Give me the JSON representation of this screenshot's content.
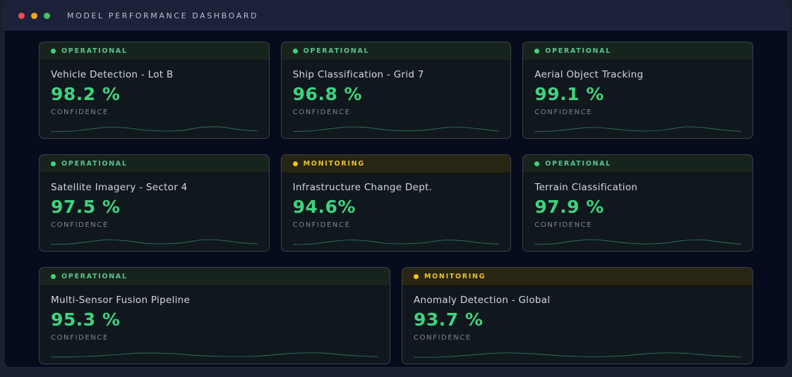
{
  "window": {
    "title": "MODEL PERFORMANCE DASHBOARD",
    "traffic_lights": [
      {
        "name": "close-button",
        "color": "#ef4d4d"
      },
      {
        "name": "minimize-button",
        "color": "#f2a71e"
      },
      {
        "name": "zoom-button",
        "color": "#3ec45f"
      }
    ]
  },
  "colors": {
    "value_green": "#3ed37e",
    "operational_accent": "#55c48c",
    "monitoring_accent": "#e8c52f",
    "card_bg": "#10171d",
    "window_bg": "#060c1c",
    "titlebar_bg": "#1b2239"
  },
  "cards": [
    {
      "status": "OPERATIONAL",
      "status_type": "operational",
      "size": "normal",
      "title": "Vehicle Detection - Lot B",
      "value": "98.2 %",
      "metric_label": "CONFIDENCE",
      "sparkline": [
        0.1,
        0.14,
        0.32,
        0.52,
        0.46,
        0.24,
        0.16,
        0.22,
        0.5,
        0.55,
        0.3,
        0.16
      ]
    },
    {
      "status": "OPERATIONAL",
      "status_type": "operational",
      "size": "normal",
      "title": "Ship Classification - Grid 7",
      "value": "96.8 %",
      "metric_label": "CONFIDENCE",
      "sparkline": [
        0.12,
        0.18,
        0.38,
        0.55,
        0.48,
        0.26,
        0.18,
        0.24,
        0.46,
        0.52,
        0.34,
        0.14
      ]
    },
    {
      "status": "OPERATIONAL",
      "status_type": "operational",
      "size": "normal",
      "title": "Aerial Object Tracking",
      "value": "99.1 %",
      "metric_label": "CONFIDENCE",
      "sparkline": [
        0.1,
        0.16,
        0.34,
        0.5,
        0.4,
        0.22,
        0.16,
        0.28,
        0.55,
        0.48,
        0.26,
        0.12
      ]
    },
    {
      "status": "OPERATIONAL",
      "status_type": "operational",
      "size": "normal",
      "title": "Satellite Imagery - Sector 4",
      "value": "97.5 %",
      "metric_label": "CONFIDENCE",
      "sparkline": [
        0.1,
        0.15,
        0.35,
        0.54,
        0.44,
        0.22,
        0.15,
        0.25,
        0.52,
        0.5,
        0.28,
        0.14
      ]
    },
    {
      "status": "MONITORING",
      "status_type": "monitoring",
      "size": "normal",
      "title": "Infrastructure Change Dept.",
      "value": "94.6%",
      "metric_label": "CONFIDENCE",
      "sparkline": [
        0.08,
        0.14,
        0.36,
        0.52,
        0.42,
        0.2,
        0.16,
        0.26,
        0.5,
        0.46,
        0.24,
        0.12
      ]
    },
    {
      "status": "OPERATIONAL",
      "status_type": "operational",
      "size": "normal",
      "title": "Terrain Classification",
      "value": "97.9 %",
      "metric_label": "CONFIDENCE",
      "sparkline": [
        0.1,
        0.16,
        0.4,
        0.55,
        0.42,
        0.22,
        0.14,
        0.24,
        0.48,
        0.52,
        0.3,
        0.12
      ]
    },
    {
      "status": "OPERATIONAL",
      "status_type": "operational",
      "size": "wide",
      "title": "Multi-Sensor Fusion Pipeline",
      "value": "95.3 %",
      "metric_label": "CONFIDENCE",
      "sparkline": [
        0.1,
        0.14,
        0.3,
        0.48,
        0.44,
        0.24,
        0.16,
        0.2,
        0.44,
        0.5,
        0.28,
        0.14
      ]
    },
    {
      "status": "MONITORING",
      "status_type": "monitoring",
      "size": "wide",
      "title": "Anomaly Detection - Global",
      "value": "93.7 %",
      "metric_label": "CONFIDENCE",
      "sparkline": [
        0.08,
        0.12,
        0.32,
        0.5,
        0.42,
        0.22,
        0.14,
        0.22,
        0.46,
        0.48,
        0.26,
        0.12
      ]
    }
  ]
}
